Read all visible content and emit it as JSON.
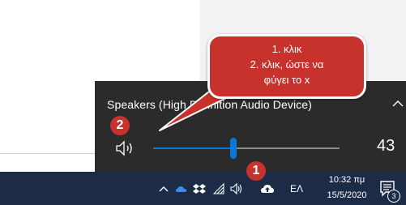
{
  "flyout": {
    "device_name": "Speakers (High Definition Audio Device)",
    "volume_value": "43",
    "volume_level": 0.43
  },
  "callout": {
    "line1": "1. κλικ",
    "line2": "2. κλικ, ώστε να",
    "line3": "φύγει το x",
    "color": "#c8322c"
  },
  "badges": {
    "one": "1",
    "two": "2"
  },
  "taskbar": {
    "language": "ΕΛ",
    "time": "10:32 πμ",
    "date": "15/5/2020",
    "notification_count": "3",
    "background": "#1c2c47"
  },
  "icons": [
    "chevron-up-icon",
    "onedrive-icon",
    "dropbox-icon",
    "wifi-icon",
    "speaker-icon",
    "cloud-upload-icon",
    "notification-icon"
  ]
}
